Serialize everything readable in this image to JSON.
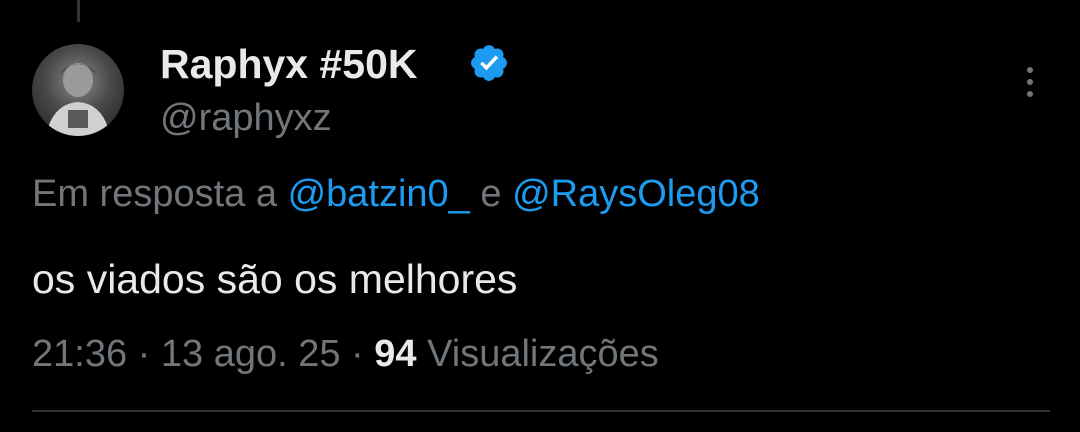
{
  "author": {
    "display_name": "Raphyx #50K",
    "handle": "@raphyxz",
    "verified": true
  },
  "reply": {
    "prefix": "Em resposta a ",
    "mention_1": "@batzin0_",
    "joiner": " e ",
    "mention_2": "@RaysOleg08"
  },
  "tweet": {
    "text": "os viados são os melhores"
  },
  "meta": {
    "time": "21:36",
    "separator": " · ",
    "date": "13 ago. 25",
    "views_count": "94",
    "views_label": " Visualizações"
  },
  "icons": {
    "verified": "verified-badge-icon",
    "more": "more-options-icon"
  },
  "colors": {
    "background": "#000000",
    "primary_text": "#e7e9ea",
    "secondary_text": "#71767b",
    "accent": "#1d9bf0"
  }
}
